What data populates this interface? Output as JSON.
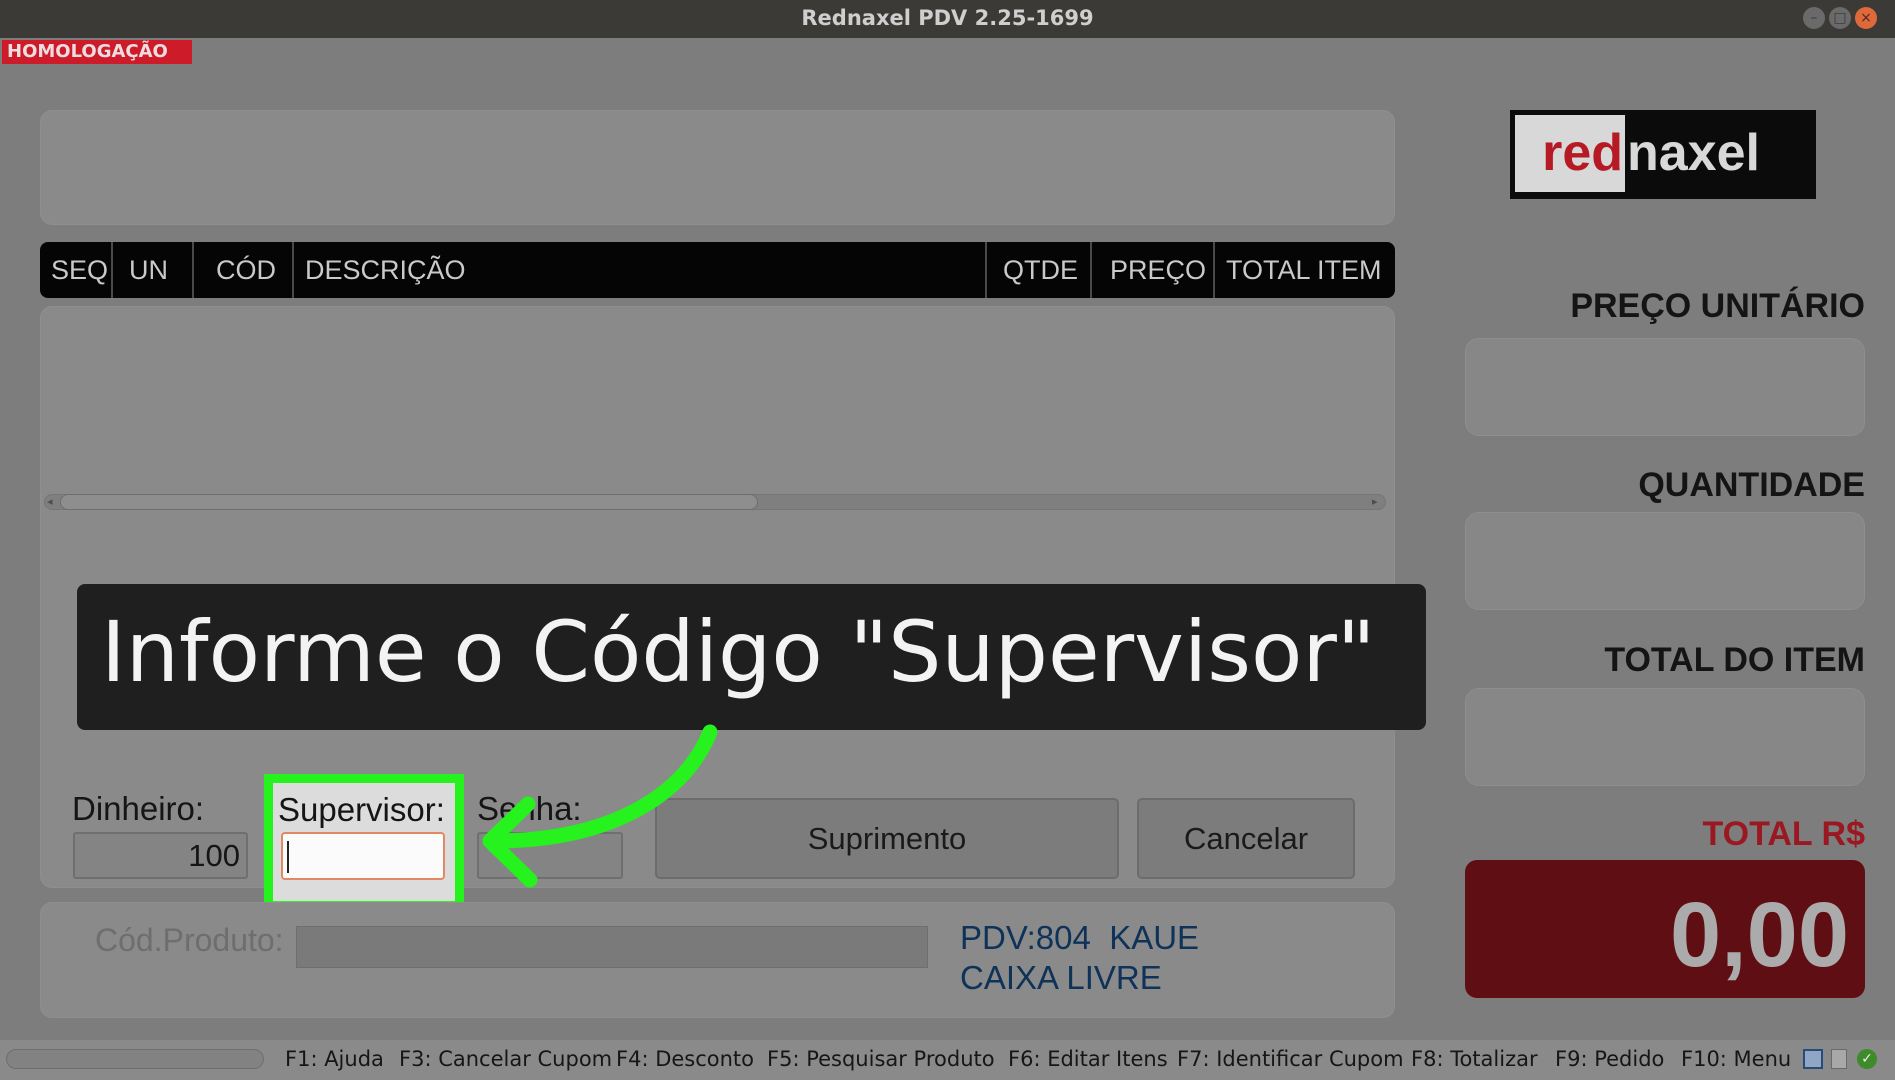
{
  "window": {
    "title": "Rednaxel PDV 2.25-1699",
    "min_icon": "minimize-icon",
    "max_icon": "maximize-icon",
    "close_icon": "close-icon"
  },
  "environment_badge": "HOMOLOGAÇÃO",
  "table": {
    "columns": [
      "SEQ",
      "UN",
      "CÓD",
      "DESCRIÇÃO",
      "QTDE",
      "PREÇO",
      "TOTAL ITEM"
    ],
    "rows": []
  },
  "logo": {
    "left": "red",
    "right": "naxel"
  },
  "right_panel": {
    "preco_unitario_label": "PREÇO UNITÁRIO",
    "preco_unitario_value": "",
    "quantidade_label": "QUANTIDADE",
    "quantidade_value": "",
    "total_item_label": "TOTAL DO ITEM",
    "total_item_value": "",
    "total_label": "TOTAL R$",
    "total_value": "0,00"
  },
  "dialog": {
    "dinheiro_label": "Dinheiro:",
    "dinheiro_value": "100",
    "supervisor_label": "Supervisor:",
    "supervisor_value": "",
    "senha_label": "Senha:",
    "senha_value": "",
    "suprimento_button": "Suprimento",
    "cancelar_button": "Cancelar"
  },
  "tutorial_overlay": {
    "text": "Informe o Código \"Supervisor\"",
    "arrow_color": "#26f21d"
  },
  "bottom": {
    "cod_produto_label": "Cód.Produto:",
    "cod_produto_value": "",
    "pdv_line": "PDV:804  KAUE",
    "status_line": "CAIXA LIVRE"
  },
  "function_keys": [
    "F1: Ajuda",
    "F3: Cancelar Cupom",
    "F4: Desconto",
    "F5: Pesquisar Produto",
    "F6: Editar Itens",
    "F7: Identificar Cupom",
    "F8: Totalizar",
    "F9: Pedido",
    "F10: Menu"
  ],
  "status_icons": [
    "window-icon",
    "document-icon",
    "check-icon"
  ],
  "colors": {
    "accent_red": "#ce1b2a",
    "total_box": "#5f0f14",
    "highlight_green": "#26f21d",
    "pdv_blue": "#0e3258"
  }
}
